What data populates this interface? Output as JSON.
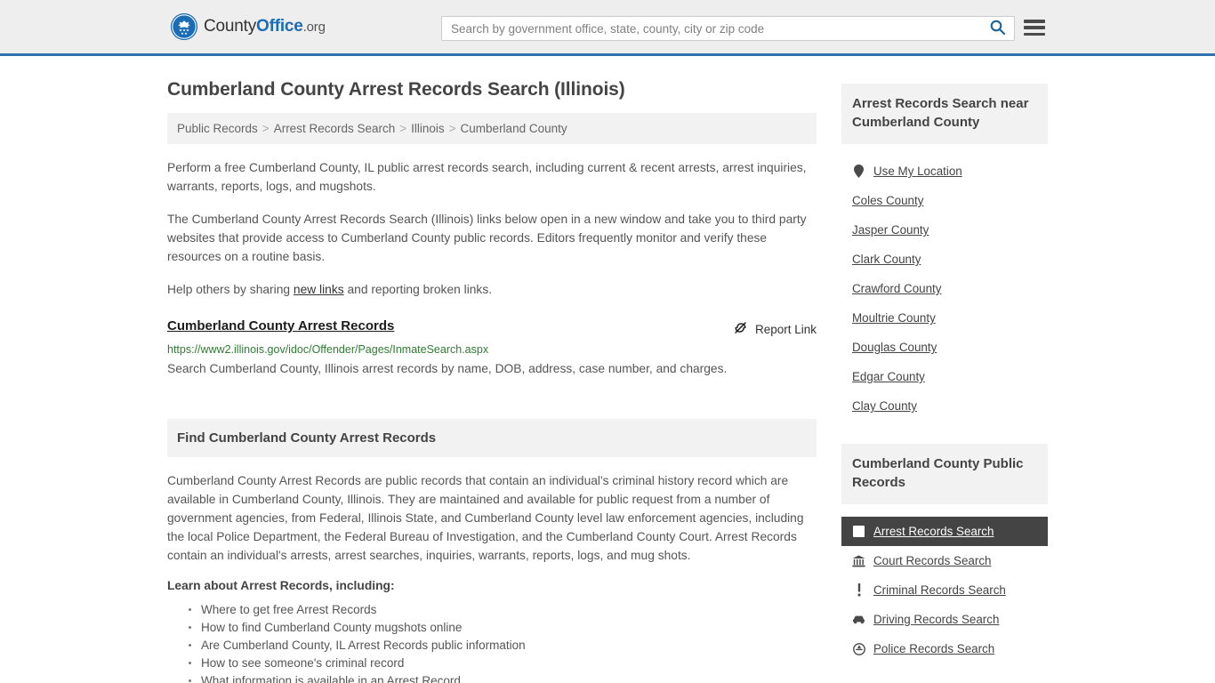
{
  "header": {
    "brand": {
      "part1": "County",
      "part2": "Office",
      "part3": ".org",
      "logo_icon": "eagle-seal-icon"
    },
    "search": {
      "placeholder": "Search by government office, state, county, city or zip code",
      "value": "",
      "icon": "search-icon"
    },
    "menu_icon": "hamburger-menu-icon",
    "accent_color": "#2e73b0",
    "background_color": "#eeeeee"
  },
  "page": {
    "title": "Cumberland County Arrest Records Search (Illinois)"
  },
  "breadcrumb": {
    "separator": ">",
    "items": [
      {
        "label": "Public Records"
      },
      {
        "label": "Arrest Records Search"
      },
      {
        "label": "Illinois"
      },
      {
        "label": "Cumberland County"
      }
    ]
  },
  "intro": {
    "p1": "Perform a free Cumberland County, IL public arrest records search, including current & recent arrests, arrest inquiries, warrants, reports, logs, and mugshots.",
    "p2": "The Cumberland County Arrest Records Search (Illinois) links below open in a new window and take you to third party websites that provide access to Cumberland County public records. Editors frequently monitor and verify these resources on a routine basis.",
    "p3_before": "Help others by sharing ",
    "p3_link": "new links",
    "p3_after": " and reporting broken links."
  },
  "result": {
    "title": "Cumberland County Arrest Records",
    "report_label": "Report Link",
    "report_icon": "broken-link-icon",
    "url": "https://www2.illinois.gov/idoc/Offender/Pages/InmateSearch.aspx",
    "description": "Search Cumberland County, Illinois arrest records by name, DOB, address, case number, and charges.",
    "url_color": "#2e7d32"
  },
  "find_section": {
    "heading": "Find Cumberland County Arrest Records",
    "body": "Cumberland County Arrest Records are public records that contain an individual's criminal history record which are available in Cumberland County, Illinois. They are maintained and available for public request from a number of government agencies, from Federal, Illinois State, and Cumberland County level law enforcement agencies, including the local Police Department, the Federal Bureau of Investigation, and the Cumberland County Court. Arrest Records contain an individual's arrests, arrest searches, inquiries, warrants, reports, logs, and mug shots.",
    "learn_heading": "Learn about Arrest Records, including:",
    "learn_items": [
      "Where to get free Arrest Records",
      "How to find Cumberland County mugshots online",
      "Are Cumberland County, IL Arrest Records public information",
      "How to see someone's criminal record",
      "What information is available in an Arrest Record"
    ]
  },
  "sidebar": {
    "nearby": {
      "heading": "Arrest Records Search near Cumberland County",
      "items": [
        {
          "label": "Use My Location",
          "icon": "map-pin-icon"
        },
        {
          "label": "Coles County",
          "icon": ""
        },
        {
          "label": "Jasper County",
          "icon": ""
        },
        {
          "label": "Clark County",
          "icon": ""
        },
        {
          "label": "Crawford County",
          "icon": ""
        },
        {
          "label": "Moultrie County",
          "icon": ""
        },
        {
          "label": "Douglas County",
          "icon": ""
        },
        {
          "label": "Edgar County",
          "icon": ""
        },
        {
          "label": "Clay County",
          "icon": ""
        }
      ]
    },
    "public_records": {
      "heading": "Cumberland County Public Records",
      "items": [
        {
          "label": "Arrest Records Search",
          "icon": "square-icon",
          "active": true
        },
        {
          "label": "Court Records Search",
          "icon": "bank-icon",
          "active": false
        },
        {
          "label": "Criminal Records Search",
          "icon": "exclamation-icon",
          "active": false
        },
        {
          "label": "Driving Records Search",
          "icon": "car-icon",
          "active": false
        },
        {
          "label": "Police Records Search",
          "icon": "police-badge-icon",
          "active": false
        }
      ],
      "active_background": "#444444"
    }
  }
}
